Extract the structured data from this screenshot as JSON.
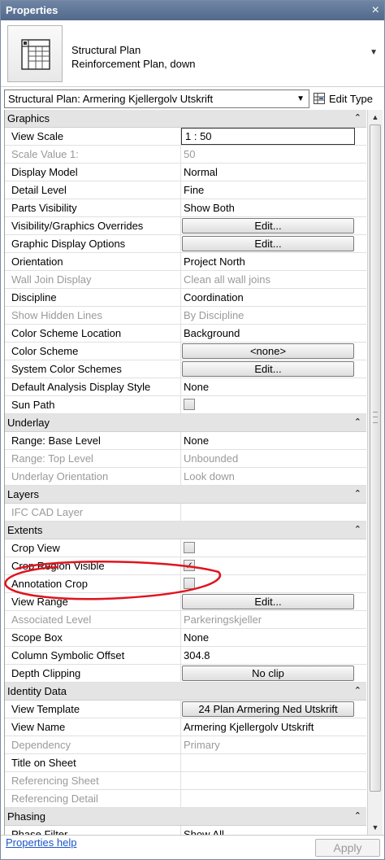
{
  "panel": {
    "title": "Properties",
    "close_glyph": "×"
  },
  "type_selector": {
    "line1": "Structural Plan",
    "line2": "Reinforcement Plan, down",
    "icon": "structural-plan-icon"
  },
  "instance": {
    "selected_view": "Structural Plan: Armering Kjellergolv Utskrift",
    "edit_type_label": "Edit Type"
  },
  "groups": {
    "graphics": "Graphics",
    "underlay": "Underlay",
    "layers": "Layers",
    "extents": "Extents",
    "identity": "Identity Data",
    "phasing": "Phasing"
  },
  "graphics": {
    "view_scale": {
      "name": "View Scale",
      "value": "1 : 50"
    },
    "scale_value": {
      "name": "Scale Value    1:",
      "value": "50"
    },
    "display_model": {
      "name": "Display Model",
      "value": "Normal"
    },
    "detail_level": {
      "name": "Detail Level",
      "value": "Fine"
    },
    "parts_visibility": {
      "name": "Parts Visibility",
      "value": "Show Both"
    },
    "vg_overrides": {
      "name": "Visibility/Graphics Overrides",
      "value": "Edit..."
    },
    "graphic_display": {
      "name": "Graphic Display Options",
      "value": "Edit..."
    },
    "orientation": {
      "name": "Orientation",
      "value": "Project North"
    },
    "wall_join": {
      "name": "Wall Join Display",
      "value": "Clean all wall joins"
    },
    "discipline": {
      "name": "Discipline",
      "value": "Coordination"
    },
    "hidden_lines": {
      "name": "Show Hidden Lines",
      "value": "By Discipline"
    },
    "color_scheme_location": {
      "name": "Color Scheme Location",
      "value": "Background"
    },
    "color_scheme": {
      "name": "Color Scheme",
      "value": "<none>"
    },
    "system_color_schemes": {
      "name": "System Color Schemes",
      "value": "Edit..."
    },
    "analysis_style": {
      "name": "Default Analysis Display Style",
      "value": "None"
    },
    "sun_path": {
      "name": "Sun Path",
      "checked": false
    }
  },
  "underlay": {
    "base_level": {
      "name": "Range: Base Level",
      "value": "None"
    },
    "top_level": {
      "name": "Range: Top Level",
      "value": "Unbounded"
    },
    "orientation": {
      "name": "Underlay Orientation",
      "value": "Look down"
    }
  },
  "layers": {
    "ifc_cad": {
      "name": "IFC CAD Layer",
      "value": ""
    }
  },
  "extents": {
    "crop_view": {
      "name": "Crop View",
      "checked": false
    },
    "crop_region_visible": {
      "name": "Crop Region Visible",
      "checked": true
    },
    "annotation_crop": {
      "name": "Annotation Crop",
      "checked": false
    },
    "view_range": {
      "name": "View Range",
      "value": "Edit..."
    },
    "associated_level": {
      "name": "Associated Level",
      "value": "Parkeringskjeller"
    },
    "scope_box": {
      "name": "Scope Box",
      "value": "None"
    },
    "column_offset": {
      "name": "Column Symbolic Offset",
      "value": "304.8"
    },
    "depth_clipping": {
      "name": "Depth Clipping",
      "value": "No clip"
    }
  },
  "identity": {
    "view_template": {
      "name": "View Template",
      "value": "24 Plan Armering Ned Utskrift"
    },
    "view_name": {
      "name": "View Name",
      "value": "Armering Kjellergolv Utskrift"
    },
    "dependency": {
      "name": "Dependency",
      "value": "Primary"
    },
    "title_on_sheet": {
      "name": "Title on Sheet",
      "value": ""
    },
    "ref_sheet": {
      "name": "Referencing Sheet",
      "value": ""
    },
    "ref_detail": {
      "name": "Referencing Detail",
      "value": ""
    }
  },
  "phasing": {
    "phase_filter": {
      "name": "Phase Filter",
      "value": "Show All"
    }
  },
  "footer": {
    "help_link": "Properties help",
    "apply_label": "Apply"
  },
  "colors": {
    "title_bar": "#5c7296",
    "group_header": "#e4e4e4",
    "disabled_text": "#9a9a9a",
    "link": "#1a55c9",
    "annotation_mark": "#e0141e"
  }
}
